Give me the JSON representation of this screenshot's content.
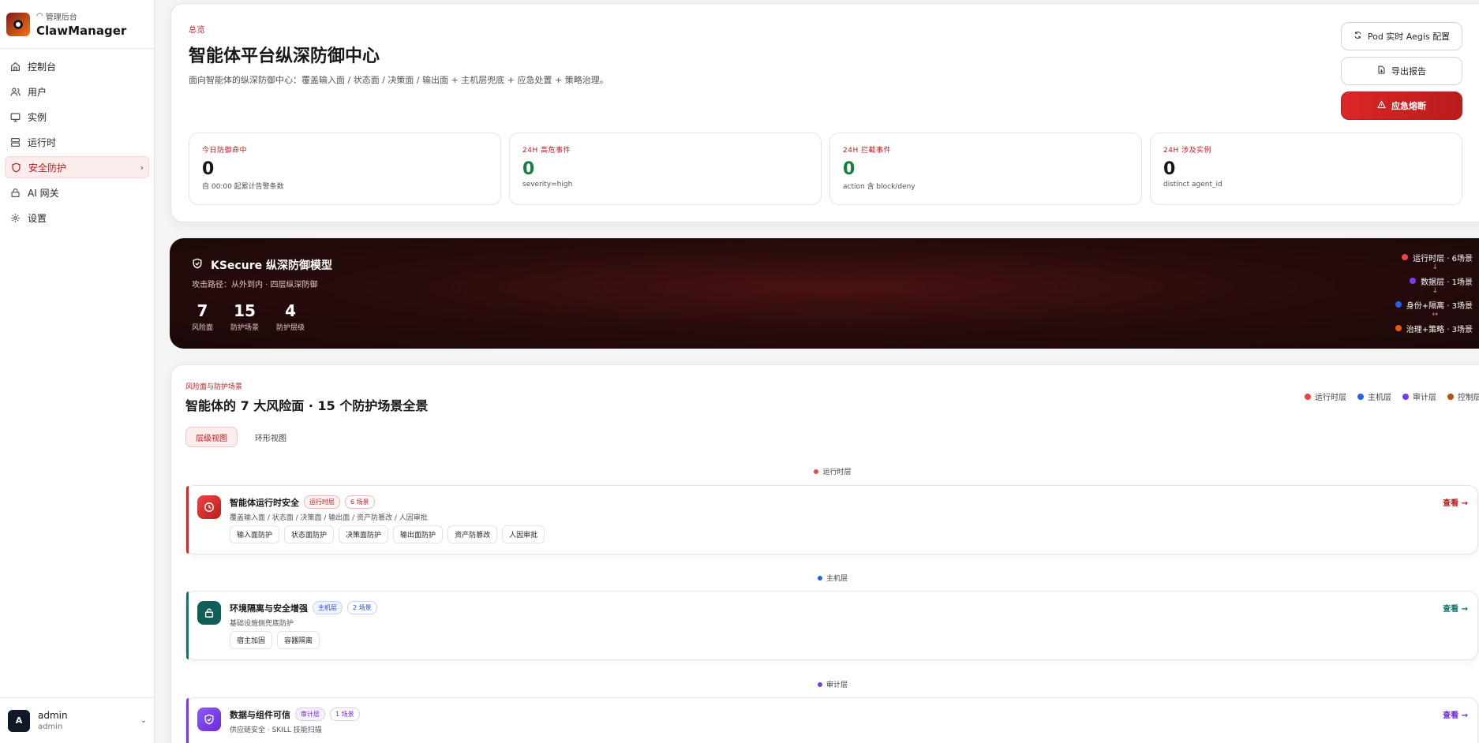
{
  "sidebar": {
    "brand_sub": "管理后台",
    "brand_name": "ClawManager",
    "items": [
      {
        "label": "控制台",
        "icon": "home-icon"
      },
      {
        "label": "用户",
        "icon": "users-icon"
      },
      {
        "label": "实例",
        "icon": "monitor-icon"
      },
      {
        "label": "运行时",
        "icon": "server-icon"
      },
      {
        "label": "安全防护",
        "icon": "shield-icon",
        "active": true
      },
      {
        "label": "AI 网关",
        "icon": "lock-icon"
      },
      {
        "label": "设置",
        "icon": "gear-icon"
      }
    ],
    "user": {
      "initial": "A",
      "name": "admin",
      "role": "admin"
    }
  },
  "overview": {
    "eyebrow": "总览",
    "title": "智能体平台纵深防御中心",
    "description": "面向智能体的纵深防御中心：覆盖输入面 / 状态面 / 决策面 / 输出面 + 主机层兜底 + 应急处置 + 策略治理。",
    "buttons": {
      "pod": "Pod 实时 Aegis 配置",
      "export": "导出报告",
      "emergency": "应急熔断"
    },
    "stats": [
      {
        "label": "今日防御命中",
        "value": "0",
        "sub": "自 00:00 起累计告警条数"
      },
      {
        "label": "24H 高危事件",
        "value": "0",
        "sub": "severity=high"
      },
      {
        "label": "24H 拦截事件",
        "value": "0",
        "sub": "action 含 block/deny"
      },
      {
        "label": "24H 涉及实例",
        "value": "0",
        "sub": "distinct agent_id"
      }
    ]
  },
  "model": {
    "title": "KSecure 纵深防御模型",
    "subtitle": "攻击路径：从外到内 · 四层纵深防御",
    "numbers": [
      {
        "value": "7",
        "label": "风险面"
      },
      {
        "value": "15",
        "label": "防护场景"
      },
      {
        "value": "4",
        "label": "防护层级"
      }
    ],
    "chain": [
      {
        "label": "运行时层 · 6场景",
        "color": "#ef4444"
      },
      {
        "label": "数据层 · 1场景",
        "color": "#7c3aed"
      },
      {
        "label": "身份+隔离 · 3场景",
        "color": "#2563eb"
      },
      {
        "label": "治理+策略 · 3场景",
        "color": "#ea580c"
      }
    ],
    "arrows": [
      "↓",
      "↓",
      "↔"
    ]
  },
  "risk": {
    "eyebrow": "风险面与防护场景",
    "title": "智能体的 7 大风险面 · 15 个防护场景全景",
    "legend": [
      {
        "label": "运行时层",
        "color": "#ef4444"
      },
      {
        "label": "主机层",
        "color": "#2563eb"
      },
      {
        "label": "审计层",
        "color": "#7c3aed"
      },
      {
        "label": "控制层",
        "color": "#b45309"
      }
    ],
    "tabs": [
      "层级视图",
      "环形视图"
    ],
    "layer_labels": [
      "运行时层",
      "主机层",
      "审计层"
    ],
    "scenes": [
      {
        "name": "智能体运行时安全",
        "layer": "运行时层",
        "count": "6 场景",
        "desc": "覆盖输入面 / 状态面 / 决策面 / 输出面 / 资产防篡改 / 人因审批",
        "chips": [
          "输入面防护",
          "状态面防护",
          "决策面防护",
          "输出面防护",
          "资产防篡改",
          "人因审批"
        ],
        "view": "查看 →",
        "color": "#dc2626"
      },
      {
        "name": "环境隔离与安全增强",
        "layer": "主机层",
        "count": "2 场景",
        "desc": "基础设施侧兜底防护",
        "chips": [
          "宿主加固",
          "容器隔离"
        ],
        "view": "查看 →",
        "color": "#0f766e"
      },
      {
        "name": "数据与组件可信",
        "layer": "审计层",
        "count": "1 场景",
        "desc": "供应链安全 · SKILL 技能扫描",
        "chips": [],
        "view": "查看 →",
        "color": "#7c3aed"
      }
    ]
  }
}
